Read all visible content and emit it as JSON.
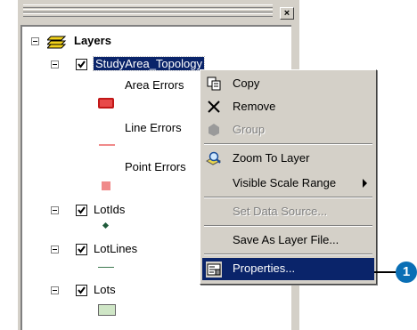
{
  "toc": {
    "close_glyph": "×",
    "root_label": "Layers",
    "layers": [
      {
        "label": "StudyArea_Topology",
        "checked": true
      },
      {
        "label": "LotIds",
        "checked": true
      },
      {
        "label": "LotLines",
        "checked": true
      },
      {
        "label": "Lots",
        "checked": true
      }
    ],
    "topology_legend": {
      "area_errors": "Area Errors",
      "line_errors": "Line Errors",
      "point_errors": "Point Errors"
    },
    "colors": {
      "area_error_fill": "#e84a4a",
      "line_error": "#f08a8a",
      "point_error": "#f08a8a",
      "lotids_marker": "#1f5a3a",
      "lotlines": "#3e7a50",
      "lots_fill": "#cfe6c6"
    }
  },
  "context_menu": {
    "items": [
      {
        "label": "Copy",
        "icon": "copy-icon",
        "enabled": true
      },
      {
        "label": "Remove",
        "icon": "remove-icon",
        "enabled": true
      },
      {
        "label": "Group",
        "icon": "group-icon",
        "enabled": false
      },
      {
        "label": "Zoom To Layer",
        "icon": "zoom-to-layer-icon",
        "enabled": true
      },
      {
        "label": "Visible Scale Range",
        "enabled": true,
        "submenu": true
      },
      {
        "label": "Set Data Source...",
        "enabled": false
      },
      {
        "label": "Save As Layer File...",
        "enabled": true
      },
      {
        "label": "Properties...",
        "icon": "properties-icon",
        "enabled": true,
        "highlighted": true
      }
    ],
    "highlight_color": "#0a246a"
  },
  "callout": {
    "number": "1",
    "color": "#0a6fb5"
  }
}
